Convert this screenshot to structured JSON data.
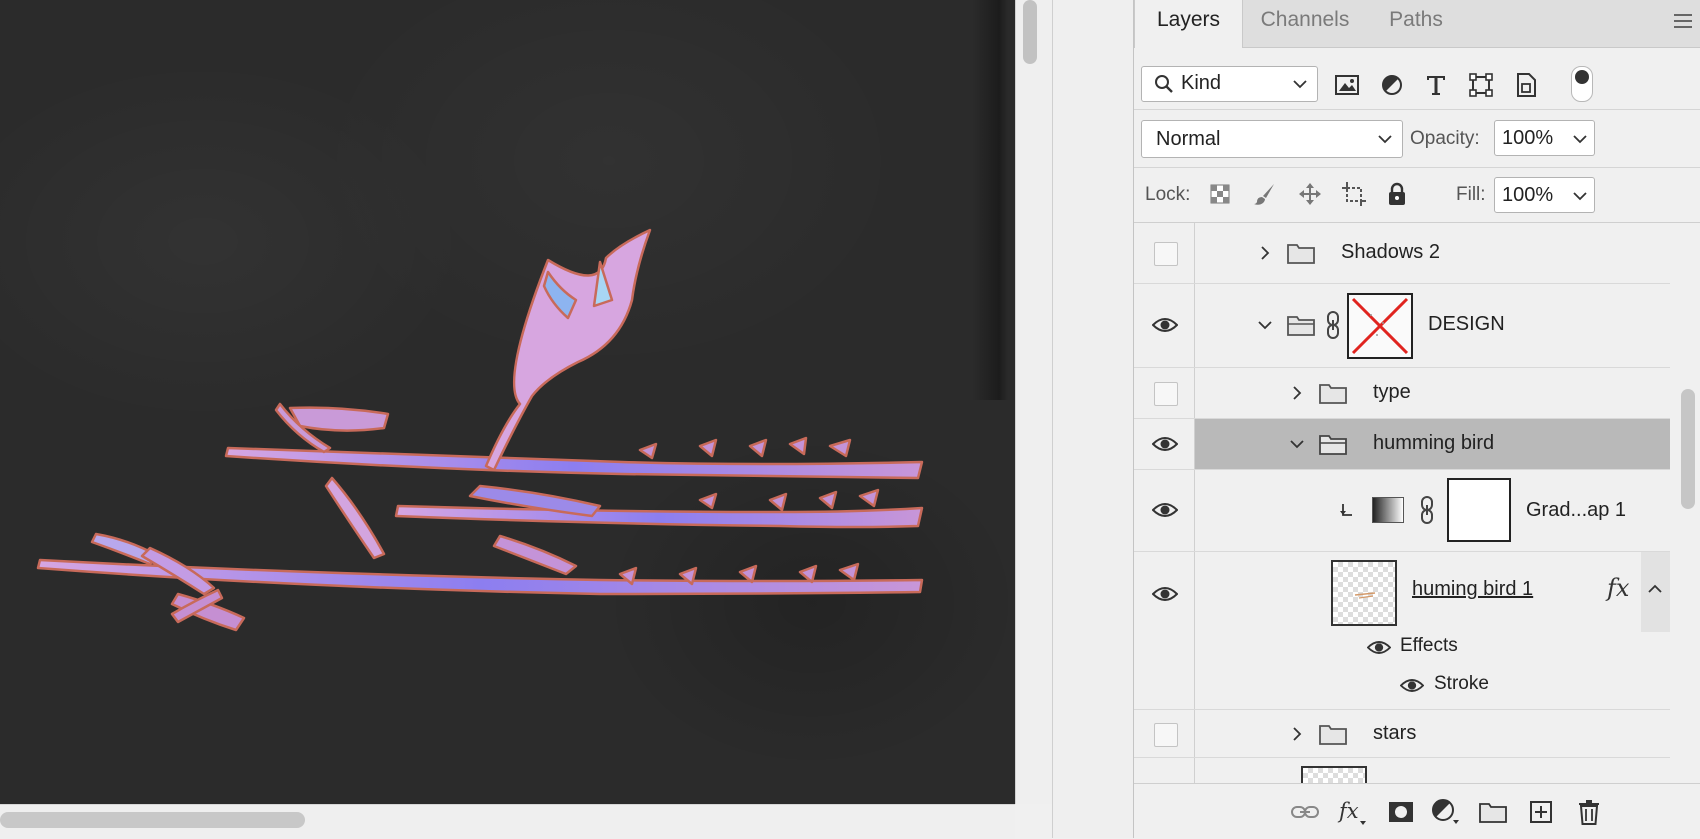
{
  "panel": {
    "tabs": [
      {
        "label": "Layers",
        "active": true
      },
      {
        "label": "Channels",
        "active": false
      },
      {
        "label": "Paths",
        "active": false
      }
    ],
    "filter": {
      "kind_label": "Kind",
      "icons": [
        "image-filter-icon",
        "adjustment-filter-icon",
        "type-filter-icon",
        "shape-filter-icon",
        "smart-object-filter-icon"
      ]
    },
    "blend_mode": "Normal",
    "opacity_label": "Opacity:",
    "opacity_value": "100%",
    "lock_label": "Lock:",
    "fill_label": "Fill:",
    "fill_value": "100%"
  },
  "layers": [
    {
      "name": "Shadows 2",
      "visible": false,
      "type": "group",
      "expanded": false
    },
    {
      "name": "DESIGN",
      "visible": true,
      "type": "group",
      "expanded": true,
      "has_mask": true
    },
    {
      "name": "type",
      "visible": false,
      "type": "group",
      "expanded": false
    },
    {
      "name": "humming bird",
      "visible": true,
      "type": "group",
      "expanded": true,
      "selected": true
    },
    {
      "name": "Grad...ap 1",
      "visible": true,
      "type": "adjustment"
    },
    {
      "name": "huming bird 1",
      "visible": true,
      "type": "pixel",
      "fx": "fx",
      "effects_label": "Effects",
      "effects": [
        "Stroke"
      ]
    },
    {
      "name": "stars",
      "visible": false,
      "type": "group",
      "expanded": false
    }
  ],
  "colors": {
    "canvas": "#2b2b2b",
    "design_purple": "#c38fd6",
    "design_blue": "#6a6cf0",
    "selected_row": "#b9b9b9",
    "mask_x": "#e0241f"
  }
}
